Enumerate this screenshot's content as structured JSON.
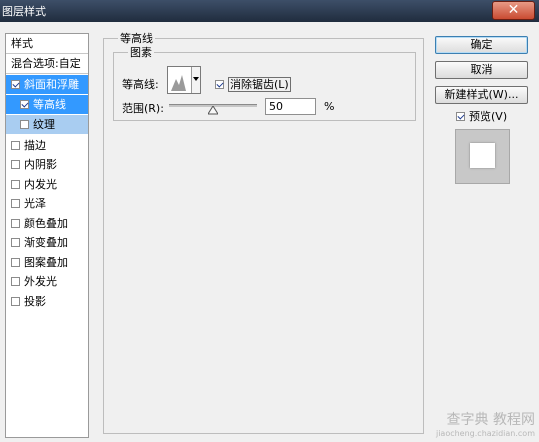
{
  "window": {
    "title": "图层样式",
    "close_glyph": "✕"
  },
  "sidebar": {
    "header": "样式",
    "blend_options": "混合选项:自定",
    "items": [
      {
        "label": "斜面和浮雕",
        "checked": true
      },
      {
        "label": "等高线",
        "checked": true
      },
      {
        "label": "纹理",
        "checked": false
      },
      {
        "label": "描边",
        "checked": false
      },
      {
        "label": "内阴影",
        "checked": false
      },
      {
        "label": "内发光",
        "checked": false
      },
      {
        "label": "光泽",
        "checked": false
      },
      {
        "label": "颜色叠加",
        "checked": false
      },
      {
        "label": "渐变叠加",
        "checked": false
      },
      {
        "label": "图案叠加",
        "checked": false
      },
      {
        "label": "外发光",
        "checked": false
      },
      {
        "label": "投影",
        "checked": false
      }
    ]
  },
  "panel": {
    "title": "等高线",
    "group_title": "图素",
    "contour_label": "等高线:",
    "antialias_label": "消除锯齿(L)",
    "antialias_checked": true,
    "range_label": "范围(R):",
    "range_value": "50",
    "range_unit": "%"
  },
  "buttons": {
    "ok": "确定",
    "cancel": "取消",
    "new_style": "新建样式(W)..."
  },
  "preview": {
    "label": "预览(V)",
    "checked": true
  },
  "watermark": {
    "line1": "查字典 教程网",
    "line2": "jiaocheng.chazidian.com"
  }
}
